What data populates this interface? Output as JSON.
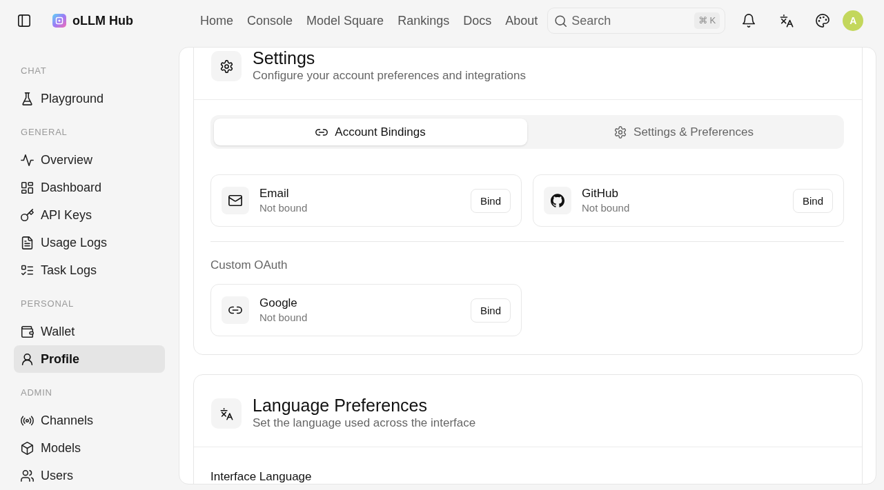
{
  "header": {
    "brand": "oLLM Hub",
    "nav": [
      "Home",
      "Console",
      "Model Square",
      "Rankings",
      "Docs",
      "About"
    ],
    "search": {
      "placeholder": "Search",
      "shortcut": "⌘ K"
    },
    "avatar": "A"
  },
  "sidebar": {
    "sections": [
      {
        "title": "CHAT",
        "items": [
          {
            "label": "Playground",
            "selected": false
          }
        ]
      },
      {
        "title": "GENERAL",
        "items": [
          {
            "label": "Overview",
            "selected": false
          },
          {
            "label": "Dashboard",
            "selected": false
          },
          {
            "label": "API Keys",
            "selected": false
          },
          {
            "label": "Usage Logs",
            "selected": false
          },
          {
            "label": "Task Logs",
            "selected": false
          }
        ]
      },
      {
        "title": "PERSONAL",
        "items": [
          {
            "label": "Wallet",
            "selected": false
          },
          {
            "label": "Profile",
            "selected": true
          }
        ]
      },
      {
        "title": "ADMIN",
        "items": [
          {
            "label": "Channels",
            "selected": false
          },
          {
            "label": "Models",
            "selected": false
          },
          {
            "label": "Users",
            "selected": false
          }
        ]
      }
    ]
  },
  "settings_card": {
    "title": "Settings",
    "subtitle": "Configure your account preferences and integrations",
    "tabs": [
      {
        "label": "Account Bindings",
        "selected": true
      },
      {
        "label": "Settings & Preferences",
        "selected": false
      }
    ],
    "bindings": [
      {
        "name": "Email",
        "status": "Not bound",
        "action": "Bind"
      },
      {
        "name": "GitHub",
        "status": "Not bound",
        "action": "Bind"
      }
    ],
    "custom_oauth": {
      "title": "Custom OAuth",
      "bindings": [
        {
          "name": "Google",
          "status": "Not bound",
          "action": "Bind"
        }
      ]
    }
  },
  "language_card": {
    "title": "Language Preferences",
    "subtitle": "Set the language used across the interface",
    "field_label": "Interface Language"
  }
}
